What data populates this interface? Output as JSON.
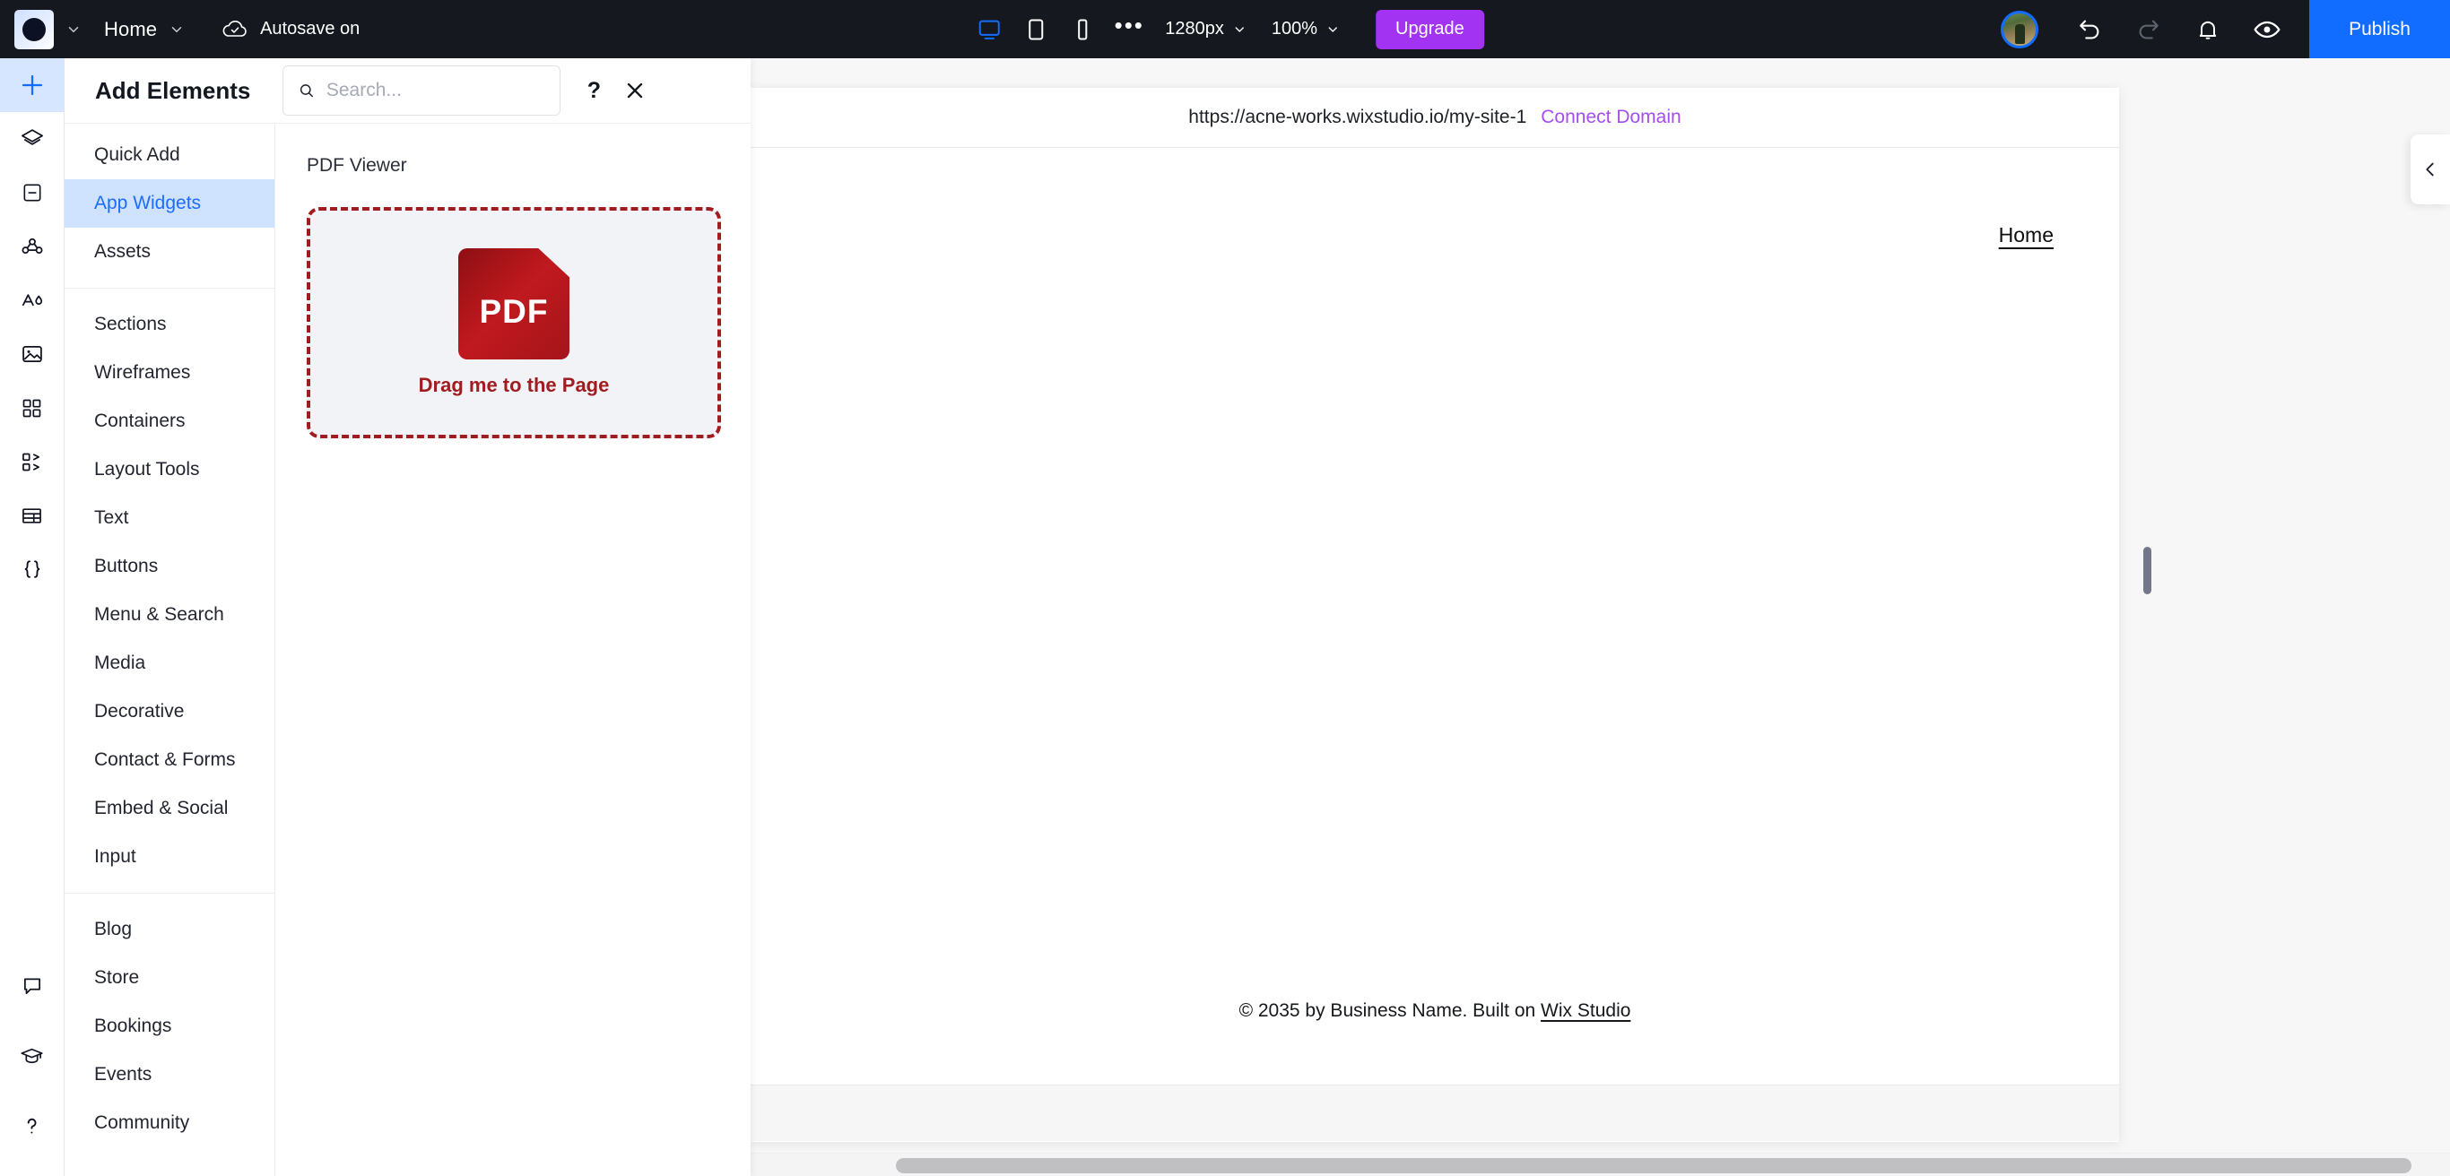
{
  "topbar": {
    "logo_icon": "wix-logo-icon",
    "logo_caret_icon": "chevron-down-icon",
    "page_name": "Home",
    "page_caret_icon": "chevron-down-icon",
    "autosave_icon": "cloud-check-icon",
    "autosave_label": "Autosave on",
    "viewports": [
      {
        "name": "desktop-viewport-button",
        "icon": "desktop-icon",
        "active": true
      },
      {
        "name": "tablet-viewport-button",
        "icon": "tablet-icon",
        "active": false
      },
      {
        "name": "mobile-viewport-button",
        "icon": "mobile-icon",
        "active": false
      }
    ],
    "more_icon": "ellipsis-icon",
    "breakpoint_value": "1280px",
    "zoom_value": "100%",
    "upgrade_label": "Upgrade",
    "avatar_icon": "user-avatar",
    "undo_icon": "undo-icon",
    "redo_icon": "redo-icon",
    "notifications_icon": "bell-icon",
    "preview_icon": "eye-icon",
    "publish_label": "Publish",
    "bg_color": "#15181f",
    "publish_color": "#116dff",
    "upgrade_color": "#a333f2"
  },
  "rail": {
    "items": [
      {
        "name": "add-elements-rail-button",
        "icon": "plus-icon",
        "active": true
      },
      {
        "name": "layers-rail-button",
        "icon": "layers-icon",
        "active": false
      },
      {
        "name": "pages-rail-button",
        "icon": "page-icon",
        "active": false
      },
      {
        "name": "cms-rail-button",
        "icon": "nodes-icon",
        "active": false
      },
      {
        "name": "site-styles-rail-button",
        "icon": "theme-icon",
        "active": false
      },
      {
        "name": "media-rail-button",
        "icon": "image-icon",
        "active": false
      },
      {
        "name": "apps-rail-button",
        "icon": "grid-icon",
        "active": false
      },
      {
        "name": "automations-rail-button",
        "icon": "flow-icon",
        "active": false
      },
      {
        "name": "tables-rail-button",
        "icon": "table-icon",
        "active": false
      },
      {
        "name": "dev-mode-rail-button",
        "icon": "code-braces-icon",
        "active": false
      }
    ],
    "bottom_items": [
      {
        "name": "chat-rail-button",
        "icon": "chat-icon"
      },
      {
        "name": "learn-rail-button",
        "icon": "graduation-cap-icon"
      },
      {
        "name": "help-rail-button",
        "icon": "question-mark-icon"
      }
    ]
  },
  "panel": {
    "title": "Add Elements",
    "search_placeholder": "Search...",
    "search_value": "",
    "search_icon": "search-icon",
    "help_label": "?",
    "close_icon": "close-icon",
    "categories_top": [
      {
        "label": "Quick Add",
        "active": false
      },
      {
        "label": "App Widgets",
        "active": true
      },
      {
        "label": "Assets",
        "active": false
      }
    ],
    "categories_mid": [
      {
        "label": "Sections",
        "active": false
      },
      {
        "label": "Wireframes",
        "active": false
      },
      {
        "label": "Containers",
        "active": false
      },
      {
        "label": "Layout Tools",
        "active": false
      },
      {
        "label": "Text",
        "active": false
      },
      {
        "label": "Buttons",
        "active": false
      },
      {
        "label": "Menu & Search",
        "active": false
      },
      {
        "label": "Media",
        "active": false
      },
      {
        "label": "Decorative",
        "active": false
      },
      {
        "label": "Contact & Forms",
        "active": false
      },
      {
        "label": "Embed & Social",
        "active": false
      },
      {
        "label": "Input",
        "active": false
      }
    ],
    "categories_bottom": [
      {
        "label": "Blog",
        "active": false
      },
      {
        "label": "Store",
        "active": false
      },
      {
        "label": "Bookings",
        "active": false
      },
      {
        "label": "Events",
        "active": false
      },
      {
        "label": "Community",
        "active": false
      }
    ],
    "widget": {
      "label": "PDF Viewer",
      "icon_text": "PDF",
      "drag_text": "Drag me to the Page",
      "border_color": "#9f1c20"
    }
  },
  "canvas": {
    "url": "https://acne-works.wixstudio.io/my-site-1",
    "connect_domain_label": "Connect Domain",
    "connect_domain_color": "#a54ef0",
    "nav_home_label": "Home",
    "footer_prefix": "© 2035 by Business Name. Built on ",
    "footer_link": "Wix Studio",
    "collapse_icon": "chevron-left-icon"
  }
}
